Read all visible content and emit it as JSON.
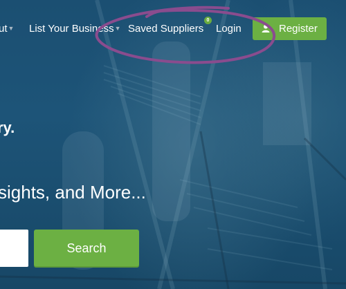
{
  "nav": {
    "about_label": "ut",
    "list_business_label": "List Your Business",
    "saved_suppliers_label": "Saved Suppliers",
    "saved_count": "0",
    "login_label": "Login",
    "register_label": "Register"
  },
  "hero": {
    "tagline": "ry.",
    "subline": "sights, and More..."
  },
  "search": {
    "input_value": "",
    "button_label": "Search"
  },
  "colors": {
    "accent_green": "#6cb043",
    "background_blue": "#1b4f72",
    "annotation_purple": "#8a4c8e"
  },
  "icons": {
    "register_icon": "user-icon",
    "dropdown_icon": "caret-down-icon"
  }
}
